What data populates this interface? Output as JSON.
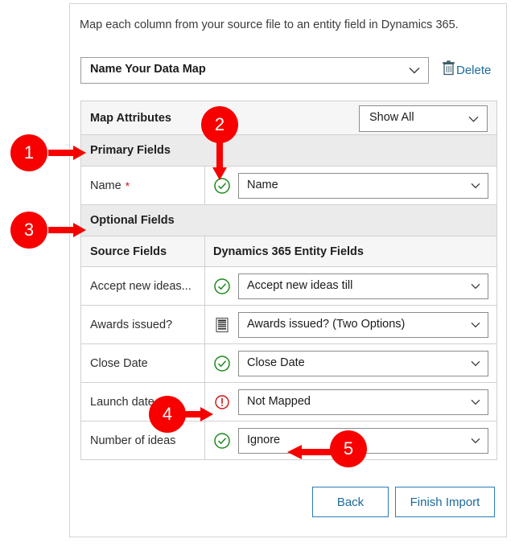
{
  "dialog": {
    "instruction": "Map each column from your source file to an entity field in Dynamics 365.",
    "map_name": {
      "value": "Name Your Data Map",
      "icon": "chevron-down-icon"
    },
    "delete": {
      "label": "Delete",
      "icon": "trash-icon"
    }
  },
  "grid": {
    "map_attributes_label": "Map Attributes",
    "show_filter": {
      "value": "Show All",
      "icon": "chevron-down-icon"
    },
    "primary_section_label": "Primary Fields",
    "primary_rows": [
      {
        "source": "Name",
        "required": "*",
        "status_icon": "green-check-icon",
        "mapped_value": "Name"
      }
    ],
    "optional_section_label": "Optional Fields",
    "columns": {
      "source": "Source Fields",
      "target": "Dynamics 365 Entity Fields"
    },
    "optional_rows": [
      {
        "source": "Accept new ideas...",
        "status_icon": "green-check-icon",
        "mapped_value": "Accept new ideas till"
      },
      {
        "source": "Awards issued?",
        "status_icon": "option-set-icon",
        "mapped_value": "Awards issued? (Two Options)"
      },
      {
        "source": "Close Date",
        "status_icon": "green-check-icon",
        "mapped_value": "Close Date"
      },
      {
        "source": "Launch date",
        "status_icon": "red-warning-icon",
        "mapped_value": "Not Mapped"
      },
      {
        "source": "Number of ideas",
        "status_icon": "green-check-icon",
        "mapped_value": "Ignore"
      }
    ]
  },
  "footer": {
    "back_label": "Back",
    "finish_label": "Finish Import"
  },
  "callouts": [
    {
      "number": "1",
      "points_to": "primary-fields-section"
    },
    {
      "number": "2",
      "points_to": "name-row-status-icon"
    },
    {
      "number": "3",
      "points_to": "optional-fields-section"
    },
    {
      "number": "4",
      "points_to": "launch-date-warning-icon"
    },
    {
      "number": "5",
      "points_to": "number-of-ideas-mapped-value"
    }
  ],
  "colors": {
    "callout_red": "#f80000",
    "link_blue": "#1a6a9c",
    "button_border_blue": "#2b7cb9",
    "status_green": "#1a8a1a",
    "status_red": "#cc1111",
    "required_star_red": "#d31717"
  }
}
